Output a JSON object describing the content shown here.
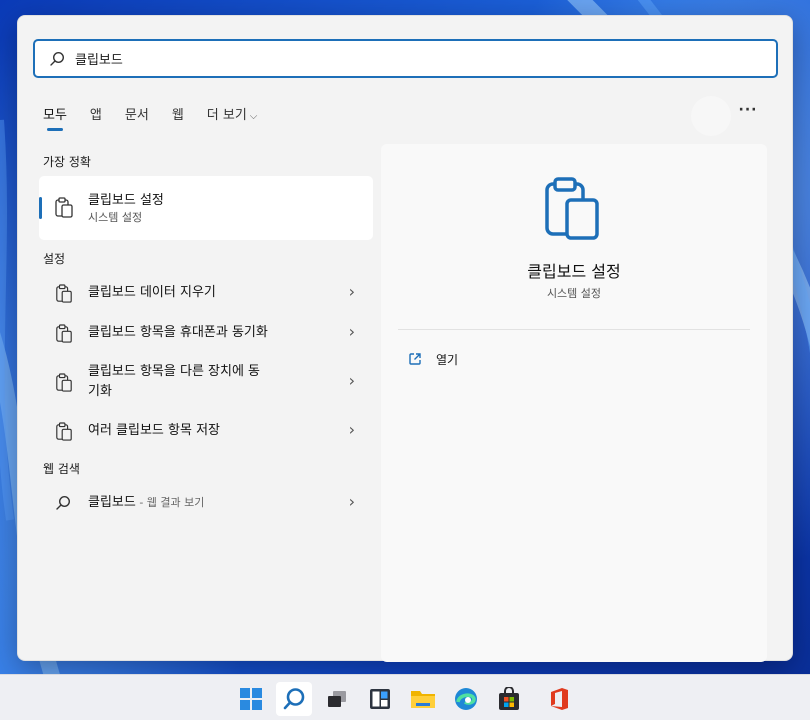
{
  "search": {
    "value": "클립보드"
  },
  "tabs": [
    {
      "label": "모두",
      "active": true
    },
    {
      "label": "앱"
    },
    {
      "label": "문서"
    },
    {
      "label": "웹"
    },
    {
      "label": "더 보기",
      "has_dropdown": true
    }
  ],
  "more_button": {
    "label": "···"
  },
  "best_match": {
    "heading": "가장 정확",
    "title": "클립보드 설정",
    "subtitle": "시스템 설정",
    "icon": "clipboard-icon"
  },
  "settings": {
    "heading": "설정",
    "items": [
      {
        "label": "클립보드 데이터 지우기",
        "icon": "clipboard-icon"
      },
      {
        "label": "클립보드 항목을 휴대폰과 동기화",
        "icon": "clipboard-icon"
      },
      {
        "label_line1": "클립보드 항목을 다른 장치에 동",
        "label_line2": "기화",
        "icon": "clipboard-icon"
      },
      {
        "label": "여러 클립보드 항목 저장",
        "icon": "clipboard-icon"
      }
    ]
  },
  "web_search": {
    "heading": "웹 검색",
    "query": "클립보드",
    "suffix": " - 웹 결과 보기",
    "icon": "search-icon"
  },
  "preview": {
    "title": "클립보드 설정",
    "subtitle": "시스템 설정",
    "actions": [
      {
        "label": "열기",
        "icon": "open-external-icon"
      }
    ]
  },
  "taskbar": {
    "apps": [
      {
        "name": "start",
        "icon": "windows-logo-icon"
      },
      {
        "name": "search",
        "icon": "search-icon",
        "active": true
      },
      {
        "name": "task-view",
        "icon": "task-view-icon"
      },
      {
        "name": "widgets",
        "icon": "widgets-icon"
      },
      {
        "name": "file-explorer",
        "icon": "folder-icon"
      },
      {
        "name": "edge",
        "icon": "edge-icon"
      },
      {
        "name": "store",
        "icon": "store-icon"
      },
      {
        "name": "office",
        "icon": "office-icon"
      }
    ]
  },
  "colors": {
    "accent": "#1d6fb8",
    "panel": "#f3f3f3",
    "preview": "#f9f9f9",
    "wallpaper": "#1d5fd6"
  }
}
